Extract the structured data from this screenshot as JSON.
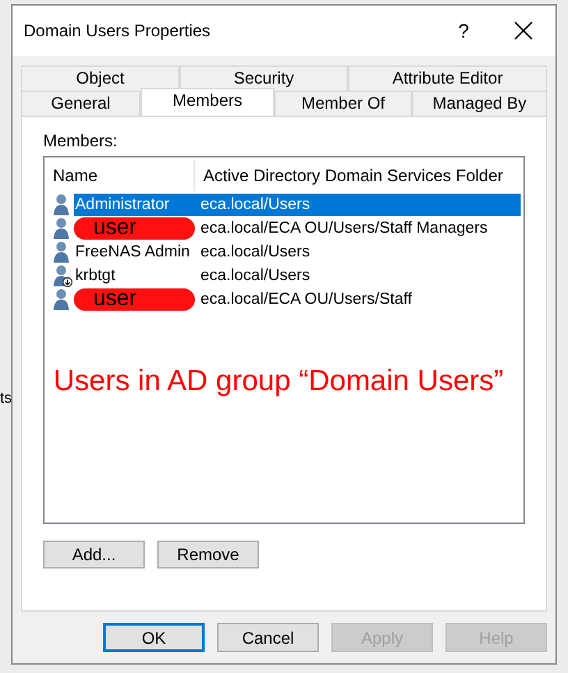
{
  "background": {
    "side_text": "ts"
  },
  "window": {
    "title": "Domain Users Properties",
    "help_label": "?"
  },
  "tabs": [
    [
      {
        "label": "Object",
        "selected": false
      },
      {
        "label": "Security",
        "selected": false
      },
      {
        "label": "Attribute Editor",
        "selected": false
      }
    ],
    [
      {
        "label": "General",
        "selected": false
      },
      {
        "label": "Members",
        "selected": true
      },
      {
        "label": "Member Of",
        "selected": false
      },
      {
        "label": "Managed By",
        "selected": false
      }
    ]
  ],
  "members": {
    "label": "Members:",
    "columns": [
      "Name",
      "Active Directory Domain Services Folder"
    ],
    "rows": [
      {
        "name": "Administrator",
        "folder": "eca.local/Users",
        "selected": true,
        "redacted": false,
        "disabled": false
      },
      {
        "name": "user",
        "folder": "eca.local/ECA OU/Users/Staff Managers",
        "selected": false,
        "redacted": true,
        "disabled": false
      },
      {
        "name": "FreeNAS Admin",
        "folder": "eca.local/Users",
        "selected": false,
        "redacted": false,
        "disabled": false
      },
      {
        "name": "krbtgt",
        "folder": "eca.local/Users",
        "selected": false,
        "redacted": false,
        "disabled": true
      },
      {
        "name": "user",
        "folder": "eca.local/ECA OU/Users/Staff",
        "selected": false,
        "redacted": true,
        "disabled": false
      }
    ]
  },
  "annotation": "Users in AD group “Domain Users”",
  "list_buttons": [
    {
      "label": "Add...",
      "disabled": false
    },
    {
      "label": "Remove",
      "disabled": false
    }
  ],
  "buttons": [
    {
      "label": "OK",
      "default": true,
      "disabled": false
    },
    {
      "label": "Cancel",
      "default": false,
      "disabled": false
    },
    {
      "label": "Apply",
      "default": false,
      "disabled": true
    },
    {
      "label": "Help",
      "default": false,
      "disabled": true
    }
  ]
}
